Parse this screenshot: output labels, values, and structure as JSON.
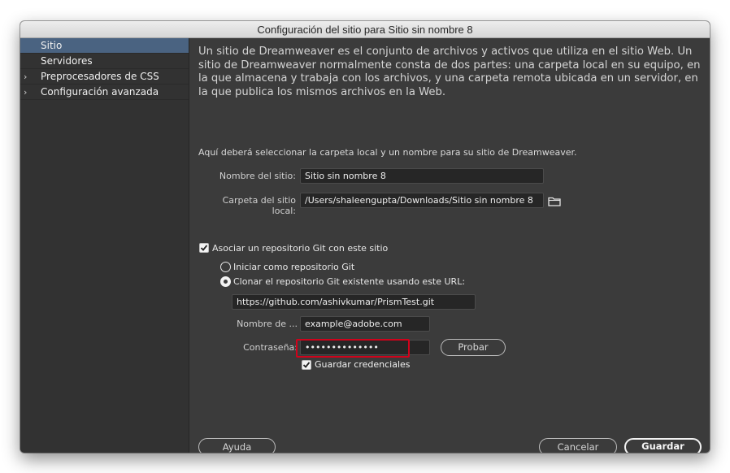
{
  "window": {
    "title": "Configuración del sitio para Sitio sin nombre 8"
  },
  "sidebar": {
    "items": [
      {
        "label": "Sitio",
        "active": true,
        "expandable": false
      },
      {
        "label": "Servidores",
        "active": false,
        "expandable": false
      },
      {
        "label": "Preprocesadores de CSS",
        "active": false,
        "expandable": true
      },
      {
        "label": "Configuración avanzada",
        "active": false,
        "expandable": true
      }
    ]
  },
  "main": {
    "intro": "Un sitio de Dreamweaver es el conjunto de archivos y activos que utiliza en el sitio Web. Un sitio de Dreamweaver normalmente consta de dos partes: una carpeta local en su equipo, en la que almacena y trabaja con los archivos, y una carpeta remota ubicada en un servidor, en la que publica los mismos archivos en la Web.",
    "hint": "Aquí deberá seleccionar la carpeta local y un nombre para su sitio de Dreamweaver.",
    "site_name": {
      "label": "Nombre del sitio:",
      "value": "Sitio sin nombre 8"
    },
    "local_folder": {
      "label": "Carpeta del sitio local:",
      "value": "/Users/shaleengupta/Downloads/Sitio sin nombre 8",
      "icon": "folder-icon"
    },
    "git": {
      "associate_label": "Asociar un repositorio Git con este sitio",
      "associate_checked": true,
      "init_label": "Iniciar como repositorio Git",
      "init_selected": false,
      "clone_label": "Clonar el repositorio Git existente usando este URL:",
      "clone_selected": true,
      "url_value": "https://github.com/ashivkumar/PrismTest.git",
      "username_label": "Nombre de ...",
      "username_value": "example@adobe.com",
      "password_label": "Contraseña:",
      "password_value": "••••••••••••••",
      "test_button": "Probar",
      "save_credentials_label": "Guardar credenciales",
      "save_credentials_checked": true
    }
  },
  "footer": {
    "help_button": "Ayuda",
    "cancel_button": "Cancelar",
    "save_button": "Guardar"
  },
  "colors": {
    "dialog_bg": "#3b3b3b",
    "sidebar_active": "#4a6381",
    "highlight": "#d0021b"
  }
}
